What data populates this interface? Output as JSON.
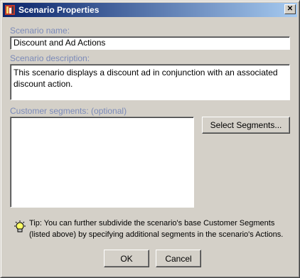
{
  "window": {
    "title": "Scenario Properties",
    "close_glyph": "✕"
  },
  "name_field": {
    "label": "Scenario name:",
    "value": "Discount and Ad Actions"
  },
  "description_field": {
    "label": "Scenario description:",
    "value": "This scenario displays a discount ad in conjunction with an associated discount action."
  },
  "segments": {
    "label": "Customer segments: (optional)",
    "select_button": "Select Segments..."
  },
  "tip": {
    "icon": "lightbulb-icon",
    "text": "Tip: You can further subdivide the scenario's base Customer Segments (listed above) by specifying additional segments in the scenario's Actions."
  },
  "buttons": {
    "ok": "OK",
    "cancel": "Cancel"
  },
  "colors": {
    "title_gradient_start": "#0a246a",
    "title_gradient_end": "#a6caf0",
    "label_color": "#7b8ab8",
    "dialog_bg": "#d4d0c8"
  }
}
